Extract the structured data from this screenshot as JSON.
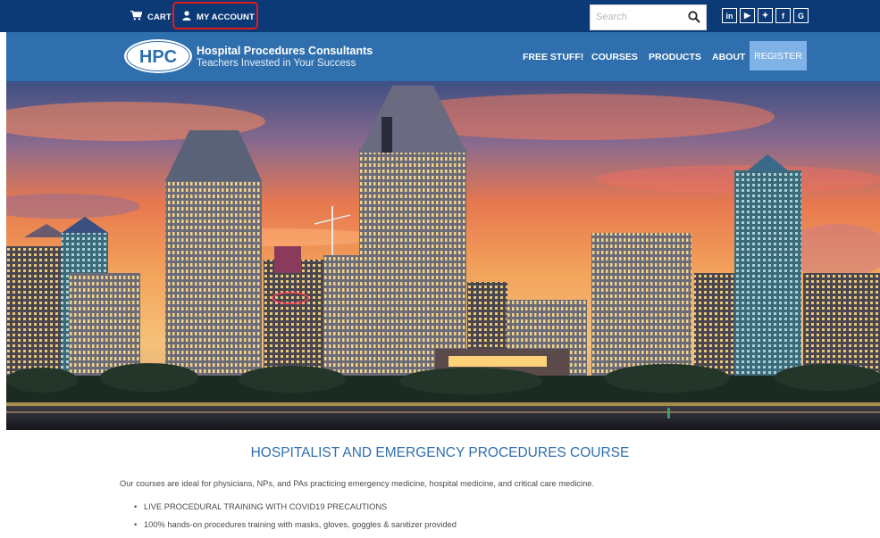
{
  "topbar": {
    "cart_label": "CART",
    "account_label": "MY ACCOUNT",
    "search_placeholder": "Search",
    "social": [
      {
        "name": "linkedin-icon",
        "glyph": "in"
      },
      {
        "name": "youtube-icon",
        "glyph": "▶"
      },
      {
        "name": "twitter-icon",
        "glyph": "✦"
      },
      {
        "name": "facebook-icon",
        "glyph": "f"
      },
      {
        "name": "google-icon",
        "glyph": "G"
      }
    ]
  },
  "brand": {
    "logo_text": "HPC",
    "name": "Hospital Procedures Consultants",
    "tagline": "Teachers Invested in Your Success"
  },
  "nav": {
    "free": "FREE STUFF!",
    "courses": "COURSES",
    "products": "PRODUCTS",
    "about": "ABOUT",
    "register": "REGISTER"
  },
  "content": {
    "title": "HOSPITALIST AND EMERGENCY PROCEDURES COURSE",
    "intro": "Our courses are ideal for physicians, NPs, and PAs practicing emergency medicine, hospital medicine, and critical care medicine.",
    "bullets": [
      "LIVE PROCEDURAL TRAINING WITH COVID19 PRECAUTIONS",
      "100% hands-on procedures training with masks, gloves, goggles & sanitizer provided"
    ]
  },
  "colors": {
    "topbar": "#0c3a77",
    "navbar": "#2f6fad",
    "register": "#7fb2e6",
    "highlight": "#e31b1b",
    "title": "#2f6fad"
  }
}
